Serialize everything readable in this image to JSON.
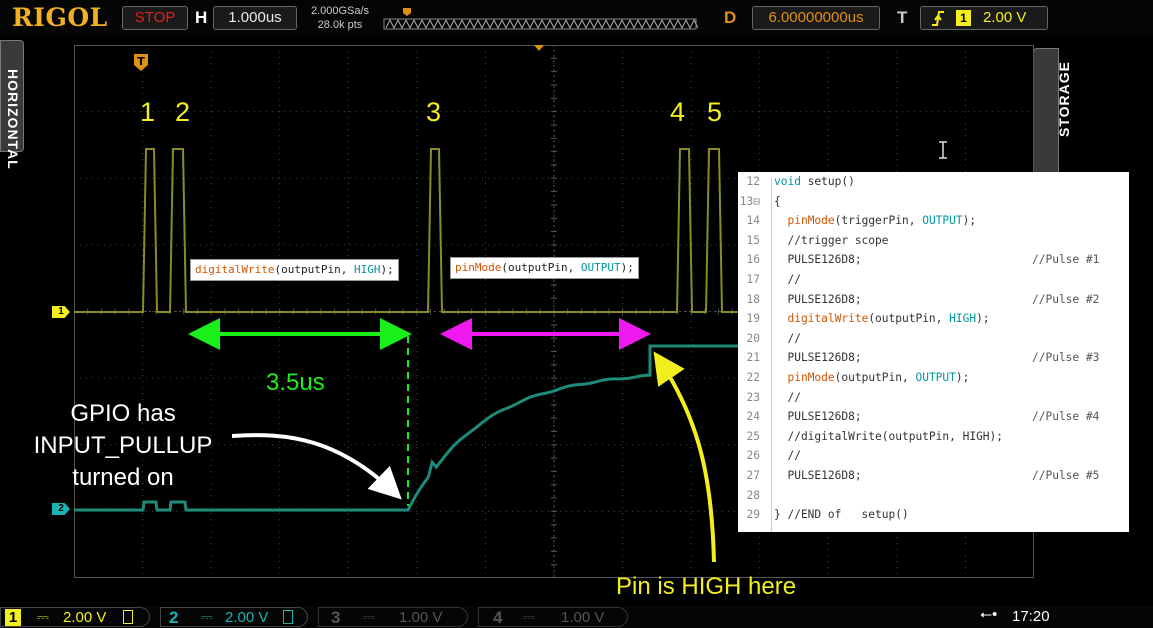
{
  "topbar": {
    "brand": "RIGOL",
    "run_state": "STOP",
    "h_label": "H",
    "timebase": "1.000us",
    "sample_rate": "2.000GSa/s",
    "memory_depth": "28.0k pts",
    "delay_label": "D",
    "delay_value": "6.00000000us",
    "trigger_label": "T",
    "trigger_channel": "1",
    "trigger_level": "2.00 V"
  },
  "side_tabs": {
    "left": "HORIZONTAL",
    "right": "STORAGE"
  },
  "markers": {
    "trigger": "T",
    "ch1": "1",
    "ch2": "2"
  },
  "pulse_numbers": [
    "1",
    "2",
    "3",
    "4",
    "5"
  ],
  "code_labels": {
    "digital_write": {
      "fn": "digitalWrite",
      "args": "(outputPin, ",
      "const": "HIGH",
      "end": ");"
    },
    "pin_mode": {
      "fn": "pinMode",
      "args": "(outputPin, ",
      "const": "OUTPUT",
      "end": ");"
    }
  },
  "annotations": {
    "duration": "3.5us",
    "gpio_note_1": "GPIO has",
    "gpio_note_2": "INPUT_PULLUP",
    "gpio_note_3": "turned on",
    "pin_high": "Pin is HIGH here"
  },
  "code_lines": [
    {
      "n": "12",
      "parts": [
        [
          "ty",
          "void"
        ],
        [
          "",
          " setup()"
        ]
      ],
      "comment": ""
    },
    {
      "n": "13⊟",
      "parts": [
        [
          "",
          "{"
        ]
      ],
      "comment": ""
    },
    {
      "n": "14",
      "parts": [
        [
          "",
          "  "
        ],
        [
          "fn",
          "pinMode"
        ],
        [
          "",
          "(triggerPin, "
        ],
        [
          "kw",
          "OUTPUT"
        ],
        [
          "",
          ");"
        ]
      ],
      "comment": ""
    },
    {
      "n": "15",
      "parts": [
        [
          "",
          "  //trigger scope"
        ]
      ],
      "comment": ""
    },
    {
      "n": "16",
      "parts": [
        [
          "",
          "  PULSE126D8;"
        ]
      ],
      "comment": "//Pulse #1"
    },
    {
      "n": "17",
      "parts": [
        [
          "",
          "  //"
        ]
      ],
      "comment": ""
    },
    {
      "n": "18",
      "parts": [
        [
          "",
          "  PULSE126D8;"
        ]
      ],
      "comment": "//Pulse #2"
    },
    {
      "n": "19",
      "parts": [
        [
          "",
          "  "
        ],
        [
          "fn",
          "digitalWrite"
        ],
        [
          "",
          "(outputPin, "
        ],
        [
          "kw",
          "HIGH"
        ],
        [
          "",
          ");"
        ]
      ],
      "comment": ""
    },
    {
      "n": "20",
      "parts": [
        [
          "",
          "  //"
        ]
      ],
      "comment": ""
    },
    {
      "n": "21",
      "parts": [
        [
          "",
          "  PULSE126D8;"
        ]
      ],
      "comment": "//Pulse #3"
    },
    {
      "n": "22",
      "parts": [
        [
          "",
          "  "
        ],
        [
          "fn",
          "pinMode"
        ],
        [
          "",
          "(outputPin, "
        ],
        [
          "kw",
          "OUTPUT"
        ],
        [
          "",
          ");"
        ]
      ],
      "comment": ""
    },
    {
      "n": "23",
      "parts": [
        [
          "",
          "  //"
        ]
      ],
      "comment": ""
    },
    {
      "n": "24",
      "parts": [
        [
          "",
          "  PULSE126D8;"
        ]
      ],
      "comment": "//Pulse #4"
    },
    {
      "n": "25",
      "parts": [
        [
          "",
          "  //digitalWrite(outputPin, HIGH);"
        ]
      ],
      "comment": ""
    },
    {
      "n": "26",
      "parts": [
        [
          "",
          "  //"
        ]
      ],
      "comment": ""
    },
    {
      "n": "27",
      "parts": [
        [
          "",
          "  PULSE126D8;"
        ]
      ],
      "comment": "//Pulse #5"
    },
    {
      "n": "28",
      "parts": [
        [
          "",
          ""
        ]
      ],
      "comment": ""
    },
    {
      "n": "29",
      "parts": [
        [
          "",
          "} //END of   setup()"
        ]
      ],
      "comment": ""
    }
  ],
  "bottombar": {
    "ch1": {
      "num": "1",
      "scale": "2.00 V"
    },
    "ch2": {
      "num": "2",
      "scale": "2.00 V"
    },
    "ch3": {
      "num": "3",
      "scale": "1.00 V"
    },
    "ch4": {
      "num": "4",
      "scale": "1.00 V"
    },
    "time": "17:20"
  },
  "colors": {
    "ch1": "#f3ef1e",
    "ch1_trace": "#8c8c22",
    "ch2": "#19b3b3",
    "ch2_trace": "#1e8a7a",
    "stop": "#e0201a",
    "accent": "#e09010",
    "green": "#19f019",
    "magenta": "#f019f0"
  }
}
